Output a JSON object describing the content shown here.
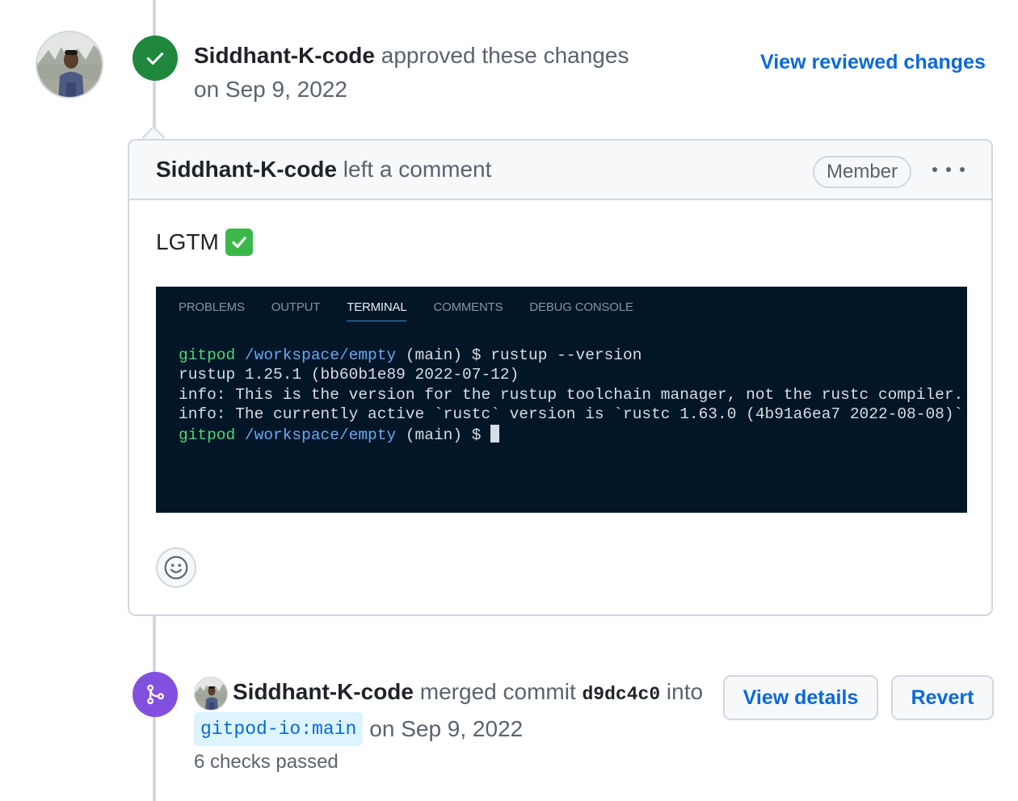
{
  "review_event": {
    "actor": "Siddhant-K-code",
    "action": "approved these changes",
    "date": "on Sep 9, 2022",
    "view_reviewed_link": "View reviewed changes"
  },
  "comment": {
    "actor": "Siddhant-K-code",
    "action": "left a comment",
    "role_badge": "Member",
    "body_text": "LGTM",
    "body_emoji": "white-check-mark-icon"
  },
  "terminal": {
    "tabs": [
      {
        "label": "PROBLEMS",
        "active": false
      },
      {
        "label": "OUTPUT",
        "active": false
      },
      {
        "label": "TERMINAL",
        "active": true
      },
      {
        "label": "COMMENTS",
        "active": false
      },
      {
        "label": "DEBUG CONSOLE",
        "active": false
      }
    ],
    "prompt_user": "gitpod",
    "prompt_path": "/workspace/empty",
    "prompt_branch": "(main) $",
    "command": "rustup --version",
    "output_lines": [
      "rustup 1.25.1 (bb60b1e89 2022-07-12)",
      "info: This is the version for the rustup toolchain manager, not the rustc compiler.",
      "info: The currently active `rustc` version is `rustc 1.63.0 (4b91a6ea7 2022-08-08)`"
    ]
  },
  "merge_event": {
    "actor": "Siddhant-K-code",
    "action": "merged commit",
    "commit_sha": "d9dc4c0",
    "into": "into",
    "branch_repo": "gitpod-io",
    "branch_sep": ":",
    "branch_name": "main",
    "date": "on Sep 9, 2022",
    "checks": "6 checks passed",
    "view_details_button": "View details",
    "revert_button": "Revert"
  },
  "colors": {
    "approved_badge": "#1f883d",
    "merged_badge": "#8250df",
    "link": "#0969da",
    "terminal_bg": "#021628"
  }
}
